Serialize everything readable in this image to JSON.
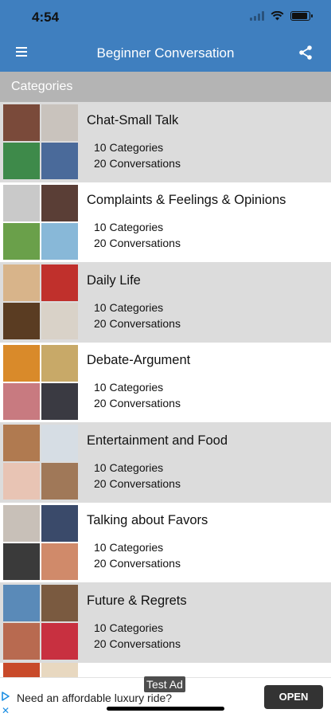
{
  "status_bar": {
    "time": "4:54"
  },
  "nav": {
    "title": "Beginner Conversation",
    "menu_icon": "hamburger-menu-icon",
    "share_icon": "share-icon"
  },
  "section": {
    "header": "Categories"
  },
  "categories": [
    {
      "title": "Chat-Small Talk",
      "categories_text": "10 Categories",
      "conversations_text": "20 Conversations",
      "photo_colors": [
        "#7a4a3a",
        "#c9c3bd",
        "#3e8a4a",
        "#4a6a9a"
      ]
    },
    {
      "title": "Complaints & Feelings & Opinions",
      "categories_text": "10 Categories",
      "conversations_text": "20 Conversations",
      "photo_colors": [
        "#c9c9c9",
        "#5a3e36",
        "#6aa04a",
        "#88b8d8"
      ]
    },
    {
      "title": "Daily Life",
      "categories_text": "10 Categories",
      "conversations_text": "20 Conversations",
      "photo_colors": [
        "#d8b48a",
        "#c0302c",
        "#5a3c22",
        "#d9d2c8"
      ]
    },
    {
      "title": "Debate-Argument",
      "categories_text": "10 Categories",
      "conversations_text": "20 Conversations",
      "photo_colors": [
        "#d98a2a",
        "#c8a968",
        "#c87a80",
        "#3a3a42"
      ]
    },
    {
      "title": "Entertainment and Food",
      "categories_text": "10 Categories",
      "conversations_text": "20 Conversations",
      "photo_colors": [
        "#b07a50",
        "#d6dde4",
        "#e8c4b4",
        "#a07858"
      ]
    },
    {
      "title": "Talking about Favors",
      "categories_text": "10 Categories",
      "conversations_text": "20 Conversations",
      "photo_colors": [
        "#c8c0b8",
        "#3a4a6a",
        "#3a3a3a",
        "#d08a6a"
      ]
    },
    {
      "title": "Future & Regrets",
      "categories_text": "10 Categories",
      "conversations_text": "20 Conversations",
      "photo_colors": [
        "#5a8ab8",
        "#7a5a40",
        "#b86a50",
        "#c83040"
      ]
    }
  ],
  "partial_row_colors": [
    "#c84a2a",
    "#e8d8c0"
  ],
  "ad": {
    "label": "Test Ad",
    "text": "Need an affordable luxury ride?",
    "button": "OPEN",
    "play_icon": "ad-choices-icon",
    "close_icon": "close-icon"
  },
  "battery_level": 0.9
}
